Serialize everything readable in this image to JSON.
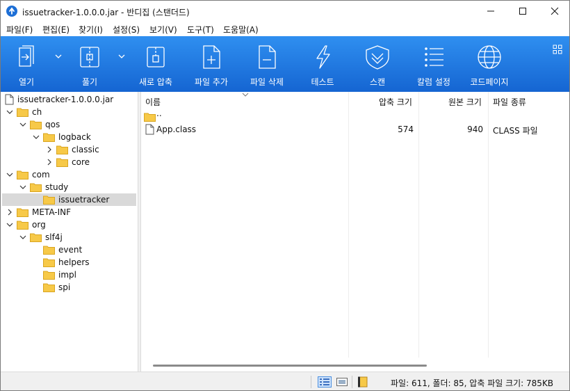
{
  "window": {
    "title": "issuetracker-1.0.0.0.jar - 반디집 (스탠더드)"
  },
  "menu": {
    "items": [
      {
        "label": "파일(F)"
      },
      {
        "label": "편집(E)"
      },
      {
        "label": "찾기(I)"
      },
      {
        "label": "설정(S)"
      },
      {
        "label": "보기(V)"
      },
      {
        "label": "도구(T)"
      },
      {
        "label": "도움말(A)"
      }
    ]
  },
  "toolbar": {
    "buttons": [
      {
        "label": "열기",
        "icon": "open-icon"
      },
      {
        "label": "풀기",
        "icon": "extract-icon"
      },
      {
        "label": "새로 압축",
        "icon": "new-archive-icon"
      },
      {
        "label": "파일 추가",
        "icon": "add-file-icon"
      },
      {
        "label": "파일 삭제",
        "icon": "delete-file-icon"
      },
      {
        "label": "테스트",
        "icon": "test-icon"
      },
      {
        "label": "스캔",
        "icon": "scan-icon"
      },
      {
        "label": "칼럼 설정",
        "icon": "column-settings-icon"
      },
      {
        "label": "코드페이지",
        "icon": "codepage-icon"
      }
    ]
  },
  "tree": {
    "items": [
      {
        "label": "issuetracker-1.0.0.0.jar",
        "kind": "file",
        "expanded": null
      },
      {
        "label": "ch",
        "kind": "folder",
        "expanded": true
      },
      {
        "label": "qos",
        "kind": "folder",
        "expanded": true
      },
      {
        "label": "logback",
        "kind": "folder",
        "expanded": true
      },
      {
        "label": "classic",
        "kind": "folder",
        "expanded": false
      },
      {
        "label": "core",
        "kind": "folder",
        "expanded": false
      },
      {
        "label": "com",
        "kind": "folder",
        "expanded": true
      },
      {
        "label": "study",
        "kind": "folder",
        "expanded": true
      },
      {
        "label": "issuetracker",
        "kind": "folder",
        "expanded": null,
        "selected": true
      },
      {
        "label": "META-INF",
        "kind": "folder",
        "expanded": false
      },
      {
        "label": "org",
        "kind": "folder",
        "expanded": true
      },
      {
        "label": "slf4j",
        "kind": "folder",
        "expanded": true
      },
      {
        "label": "event",
        "kind": "folder",
        "expanded": null
      },
      {
        "label": "helpers",
        "kind": "folder",
        "expanded": null
      },
      {
        "label": "impl",
        "kind": "folder",
        "expanded": null
      },
      {
        "label": "spi",
        "kind": "folder",
        "expanded": null
      }
    ]
  },
  "filelist": {
    "columns": {
      "name": "이름",
      "packed": "압축 크기",
      "original": "원본 크기",
      "type": "파일 종류"
    },
    "rows": [
      {
        "name": "..",
        "packed": "",
        "original": "",
        "type": "",
        "kind": "folder"
      },
      {
        "name": "App.class",
        "packed": "574",
        "original": "940",
        "type": "CLASS 파일",
        "kind": "file"
      }
    ]
  },
  "status": {
    "text": "파일: 611, 폴더: 85, 압축 파일 크기: 785KB"
  },
  "colors": {
    "toolbar_top": "#2f8ff0",
    "toolbar_bottom": "#1565d2",
    "folder": "#f7c948",
    "selection": "#d9d9d9"
  }
}
